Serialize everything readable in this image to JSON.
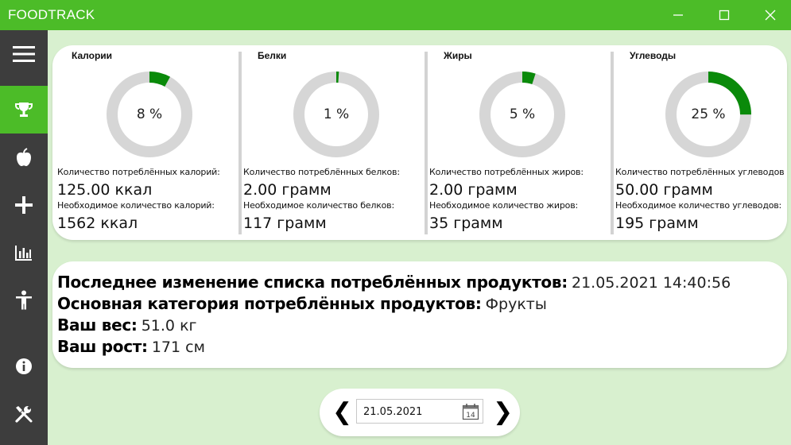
{
  "window": {
    "title": "FOODTRACK"
  },
  "sidebar": {
    "items": [
      {
        "icon": "hamburger-menu-icon"
      },
      {
        "icon": "trophy-icon",
        "active": true
      },
      {
        "icon": "apple-icon"
      },
      {
        "icon": "plus-icon"
      },
      {
        "icon": "bar-chart-icon"
      },
      {
        "icon": "person-icon"
      },
      {
        "icon": "info-icon"
      },
      {
        "icon": "tools-icon"
      }
    ]
  },
  "stats": [
    {
      "title": "Калории",
      "percent": 8,
      "percent_text": "8 %",
      "consumed_label": "Количество потреблённых калорий:",
      "consumed_value": "125.00 ккал",
      "required_label": "Необходимое количество калорий:",
      "required_value": "1562 ккал"
    },
    {
      "title": "Белки",
      "percent": 1,
      "percent_text": "1 %",
      "consumed_label": "Количество потреблённых белков:",
      "consumed_value": "2.00 грамм",
      "required_label": "Необходимое количество белков:",
      "required_value": "117 грамм"
    },
    {
      "title": "Жиры",
      "percent": 5,
      "percent_text": "5 %",
      "consumed_label": "Количество потреблённых жиров:",
      "consumed_value": "2.00 грамм",
      "required_label": "Необходимое количество жиров:",
      "required_value": "35 грамм"
    },
    {
      "title": "Углеводы",
      "percent": 25,
      "percent_text": "25 %",
      "consumed_label": "Количество потреблённых углеводов",
      "consumed_value": "50.00 грамм",
      "required_label": "Необходимое количество углеводов:",
      "required_value": "195 грамм"
    }
  ],
  "info": {
    "last_change_label": "Последнее изменение списка потреблённых продуктов:",
    "last_change_value": "21.05.2021 14:40:56",
    "category_label": "Основная категория потреблённых продуктов:",
    "category_value": "Фрукты",
    "weight_label": "Ваш вес:",
    "weight_value": "51.0 кг",
    "height_label": "Ваш рост:",
    "height_value": "171 см"
  },
  "date_picker": {
    "value": "21.05.2021",
    "prev": "❮",
    "next": "❯",
    "calendar_day": "14"
  },
  "colors": {
    "accent": "#4cbc28",
    "sidebar": "#3d3d3d",
    "ring_fill": "#0a8a0a",
    "ring_track": "#d6d6d6",
    "background": "#d8f0cf"
  }
}
